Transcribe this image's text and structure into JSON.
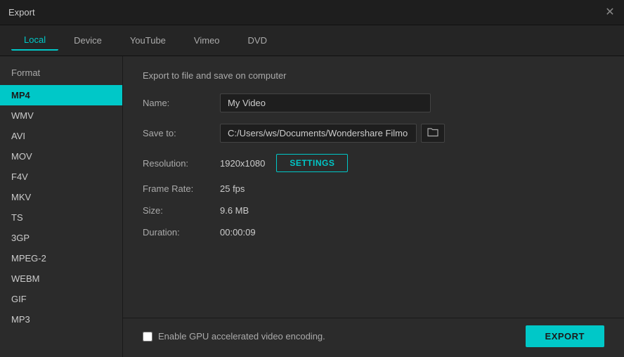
{
  "titleBar": {
    "title": "Export"
  },
  "tabs": [
    {
      "id": "local",
      "label": "Local",
      "active": true
    },
    {
      "id": "device",
      "label": "Device",
      "active": false
    },
    {
      "id": "youtube",
      "label": "YouTube",
      "active": false
    },
    {
      "id": "vimeo",
      "label": "Vimeo",
      "active": false
    },
    {
      "id": "dvd",
      "label": "DVD",
      "active": false
    }
  ],
  "sidebar": {
    "header": "Format",
    "items": [
      {
        "label": "MP4",
        "active": true
      },
      {
        "label": "WMV",
        "active": false
      },
      {
        "label": "AVI",
        "active": false
      },
      {
        "label": "MOV",
        "active": false
      },
      {
        "label": "F4V",
        "active": false
      },
      {
        "label": "MKV",
        "active": false
      },
      {
        "label": "TS",
        "active": false
      },
      {
        "label": "3GP",
        "active": false
      },
      {
        "label": "MPEG-2",
        "active": false
      },
      {
        "label": "WEBM",
        "active": false
      },
      {
        "label": "GIF",
        "active": false
      },
      {
        "label": "MP3",
        "active": false
      }
    ]
  },
  "main": {
    "subtitle": "Export to file and save on computer",
    "fields": {
      "name": {
        "label": "Name:",
        "value": "My Video"
      },
      "saveTo": {
        "label": "Save to:",
        "value": "C:/Users/ws/Documents/Wondershare Filmo"
      },
      "resolution": {
        "label": "Resolution:",
        "value": "1920x1080"
      },
      "frameRate": {
        "label": "Frame Rate:",
        "value": "25 fps"
      },
      "size": {
        "label": "Size:",
        "value": "9.6 MB"
      },
      "duration": {
        "label": "Duration:",
        "value": "00:00:09"
      }
    },
    "settingsBtn": "SETTINGS",
    "gpuLabel": "Enable GPU accelerated video encoding.",
    "exportBtn": "EXPORT"
  }
}
